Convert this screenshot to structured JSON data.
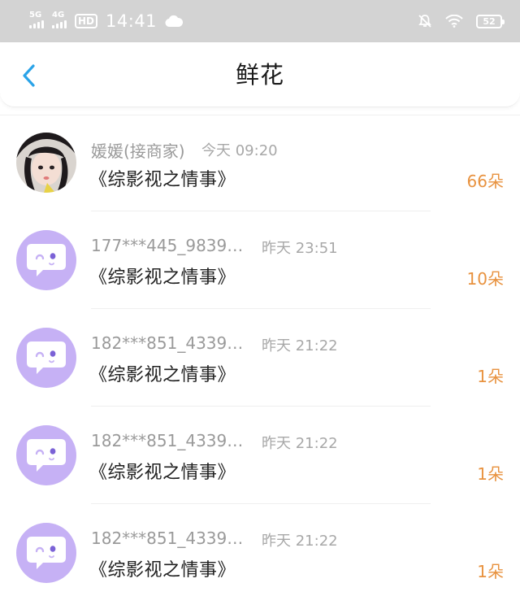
{
  "status_bar": {
    "net_1": "5G",
    "net_2": "4G",
    "hd_label": "HD",
    "time": "14:41",
    "battery": "52"
  },
  "header": {
    "title": "鲜花",
    "back_icon": "chevron-left-icon"
  },
  "colors": {
    "accent_blue": "#2aa3e8",
    "count_orange": "#e8923f",
    "avatar_purple": "#c6b1f5"
  },
  "items": [
    {
      "name": "媛媛(接商家)",
      "time": "今天 09:20",
      "work": "《综影视之情事》",
      "count": "66朵",
      "avatar": "photo-avatar"
    },
    {
      "name": "177***445_9839…",
      "time": "昨天 23:51",
      "work": "《综影视之情事》",
      "count": "10朵",
      "avatar": "chat-bubble-avatar-icon"
    },
    {
      "name": "182***851_4339…",
      "time": "昨天 21:22",
      "work": "《综影视之情事》",
      "count": "1朵",
      "avatar": "chat-bubble-avatar-icon"
    },
    {
      "name": "182***851_4339…",
      "time": "昨天 21:22",
      "work": "《综影视之情事》",
      "count": "1朵",
      "avatar": "chat-bubble-avatar-icon"
    },
    {
      "name": "182***851_4339…",
      "time": "昨天 21:22",
      "work": "《综影视之情事》",
      "count": "1朵",
      "avatar": "chat-bubble-avatar-icon"
    }
  ]
}
